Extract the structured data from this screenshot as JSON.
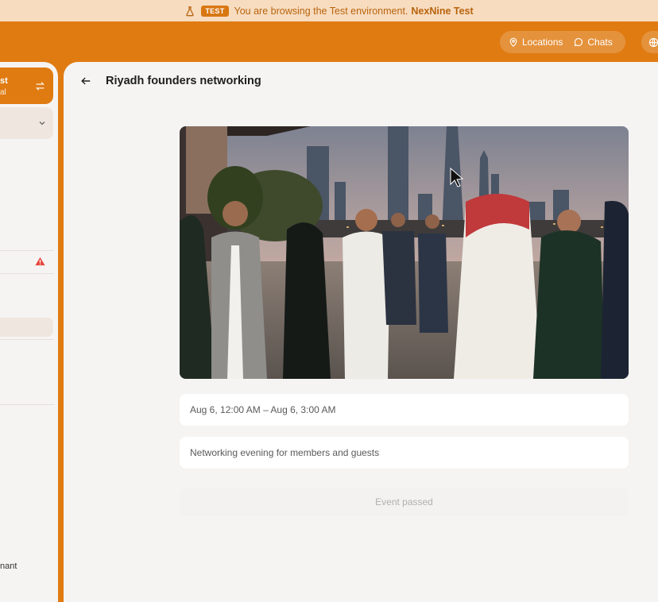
{
  "banner": {
    "badge": "TEST",
    "message": "You are browsing the Test environment.",
    "brand": "NexNine Test"
  },
  "topbar": {
    "locations_label": "Locations",
    "chats_label": "Chats"
  },
  "sidebar": {
    "active_title": "st",
    "active_subtitle": "al",
    "bottom_text": "nant"
  },
  "event": {
    "title": "Riyadh founders networking",
    "datetime": "Aug 6, 12:00 AM – Aug 6, 3:00 AM",
    "description": "Networking evening for members and guests",
    "status": "Event passed"
  },
  "colors": {
    "accent": "#e07b12",
    "banner_bg": "#f7dcc0",
    "page_bg": "#f5f4f3"
  }
}
